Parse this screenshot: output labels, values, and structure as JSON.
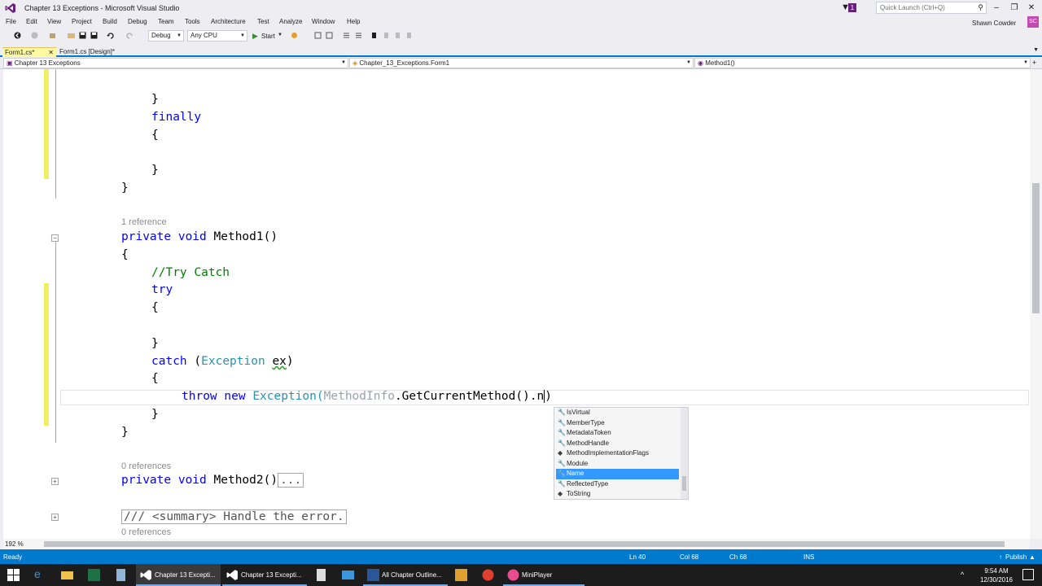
{
  "window": {
    "title": "Chapter 13 Exceptions - Microsoft Visual Studio",
    "notification_count": "1",
    "quick_launch_placeholder": "Quick Launch (Ctrl+Q)",
    "user_name": "Shawn Cowder",
    "user_initials": "SC",
    "accent_color": "#68217a"
  },
  "menu": [
    "File",
    "Edit",
    "View",
    "Project",
    "Build",
    "Debug",
    "Team",
    "Tools",
    "Architecture",
    "Test",
    "Analyze",
    "Window",
    "Help"
  ],
  "toolbar": {
    "config": "Debug",
    "platform": "Any CPU",
    "start_label": "Start"
  },
  "doc_tabs": [
    {
      "label": "Form1.cs*",
      "active": true
    },
    {
      "label": "Form1.cs [Design]*",
      "active": false
    }
  ],
  "navbar": {
    "project": "Chapter 13 Exceptions",
    "class": "Chapter_13_Exceptions.Form1",
    "member": "Method1()"
  },
  "code": {
    "lines": {
      "l1": "{",
      "l2": "}",
      "l3": "finally",
      "l4": "{",
      "l5": "}",
      "l6": "}",
      "ref1": "1 reference",
      "m1_kw1": "private",
      "m1_kw2": "void",
      "m1_name": "Method1()",
      "l8": "{",
      "comment": "//Try Catch",
      "try": "try",
      "l10": "{",
      "l11": "}",
      "catch": "catch",
      "catch_open": " (",
      "catch_type": "Exception",
      "catch_var": "ex",
      "catch_close": ")",
      "l13": "{",
      "throw": "throw",
      "new": "new",
      "exc_type": "Exception(",
      "methodinfo": "MethodInfo",
      "rest": ".GetCurrentMethod().n",
      "close_paren": ")",
      "l15": "}",
      "l16": "}",
      "ref2": "0 references",
      "m2_kw1": "private",
      "m2_kw2": "void",
      "m2_name": "Method2()",
      "m2_collapsed": "...",
      "summary": "/// <summary> Handle the error.",
      "ref3": "0 references"
    }
  },
  "intellisense": {
    "items": [
      "IsVirtual",
      "MemberType",
      "MetadataToken",
      "MethodHandle",
      "MethodImplementationFlags",
      "Module",
      "Name",
      "ReflectedType",
      "ToString"
    ],
    "selected": "Name"
  },
  "zoom": "192 %",
  "status": {
    "state": "Ready",
    "ln": "Ln 40",
    "col": "Col 68",
    "ch": "Ch 68",
    "mode": "INS",
    "publish": "Publish"
  },
  "taskbar": {
    "items": [
      "Chapter 13 Excepti...",
      "Chapter 13 Excepti...",
      "All Chapter Outline...",
      "MiniPlayer"
    ],
    "time": "9:54 AM",
    "date": "12/30/2016"
  }
}
